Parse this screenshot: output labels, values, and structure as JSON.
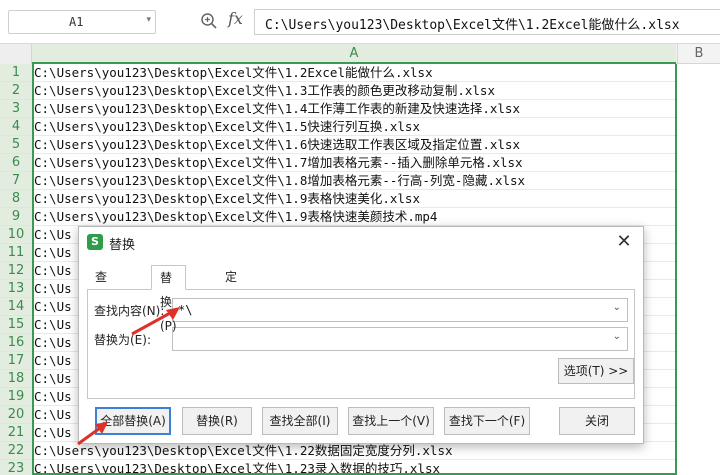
{
  "formula_bar": {
    "name_box": "A1",
    "fx_label": "fx",
    "formula": "C:\\Users\\you123\\Desktop\\Excel文件\\1.2Excel能做什么.xlsx"
  },
  "grid": {
    "columns": [
      "A",
      "B"
    ],
    "rows": [
      "1",
      "2",
      "3",
      "4",
      "5",
      "6",
      "7",
      "8",
      "9",
      "10",
      "11",
      "12",
      "13",
      "14",
      "15",
      "16",
      "17",
      "18",
      "19",
      "20",
      "21",
      "22",
      "23"
    ],
    "cells": [
      "C:\\Users\\you123\\Desktop\\Excel文件\\1.2Excel能做什么.xlsx",
      "C:\\Users\\you123\\Desktop\\Excel文件\\1.3工作表的颜色更改移动复制.xlsx",
      "C:\\Users\\you123\\Desktop\\Excel文件\\1.4工作薄工作表的新建及快速选择.xlsx",
      "C:\\Users\\you123\\Desktop\\Excel文件\\1.5快速行列互换.xlsx",
      "C:\\Users\\you123\\Desktop\\Excel文件\\1.6快速选取工作表区域及指定位置.xlsx",
      "C:\\Users\\you123\\Desktop\\Excel文件\\1.7增加表格元素--插入删除单元格.xlsx",
      "C:\\Users\\you123\\Desktop\\Excel文件\\1.8增加表格元素--行高-列宽-隐藏.xlsx",
      "C:\\Users\\you123\\Desktop\\Excel文件\\1.9表格快速美化.xlsx",
      "C:\\Users\\you123\\Desktop\\Excel文件\\1.9表格快速美颜技术.mp4",
      "C:\\Us",
      "C:\\Us",
      "C:\\Us",
      "C:\\Us",
      "C:\\Us",
      "C:\\Us",
      "C:\\Us",
      "C:\\Us",
      "C:\\Us",
      "C:\\Us",
      "C:\\Us",
      "C:\\Us",
      "C:\\Users\\you123\\Desktop\\Excel文件\\1.22数据固定宽度分列.xlsx",
      "C:\\Users\\you123\\Desktop\\Excel文件\\1.23录入数据的技巧.xlsx"
    ]
  },
  "dialog": {
    "icon_glyph": "S",
    "title": "替换",
    "close_glyph": "✕",
    "tabs": [
      "查找(D)",
      "替换(P)",
      "定位(G)"
    ],
    "find_label": "查找内容(N):",
    "find_value": "*\\",
    "replace_label": "替换为(E):",
    "replace_value": "",
    "options_button": "选项(T) >>",
    "buttons": {
      "replace_all": "全部替换(A)",
      "replace": "替换(R)",
      "find_all": "查找全部(I)",
      "find_prev": "查找上一个(V)",
      "find_next": "查找下一个(F)",
      "close": "关闭"
    }
  },
  "colors": {
    "accent_green": "#3a9a52",
    "annotation_red": "#e0302a",
    "focus_blue": "#3b80d8"
  }
}
